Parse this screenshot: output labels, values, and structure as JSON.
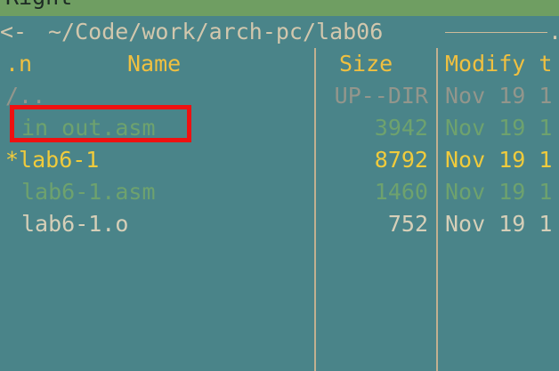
{
  "panel": {
    "title": "Right",
    "path": "~/Code/work/arch-pc/lab06",
    "frame_left": "<-",
    "frame_right": "."
  },
  "columns": {
    "sort": ".n",
    "name": "Name",
    "size": "Size",
    "modify": "Modify t"
  },
  "files": [
    {
      "name": "/..",
      "size": "UP--DIR",
      "modified": "Nov 19 1",
      "kind": "updir"
    },
    {
      "name": "in_out.asm",
      "size": "3942",
      "modified": "Nov 19 1",
      "kind": "source",
      "highlighted": true
    },
    {
      "name": "*lab6-1",
      "size": "8792",
      "modified": "Nov 19 1",
      "kind": "executable"
    },
    {
      "name": "lab6-1.asm",
      "size": "1460",
      "modified": "Nov 19 1",
      "kind": "source"
    },
    {
      "name": "lab6-1.o",
      "size": "752",
      "modified": "Nov 19 1",
      "kind": "object"
    }
  ],
  "colors": {
    "panel_bg": "#4a8489",
    "menubar_bg": "#6f9e62",
    "header_text": "#f0c040",
    "source_file": "#6ea26e",
    "executable_file": "#f0cb3c",
    "highlight_border": "#ee1111"
  }
}
